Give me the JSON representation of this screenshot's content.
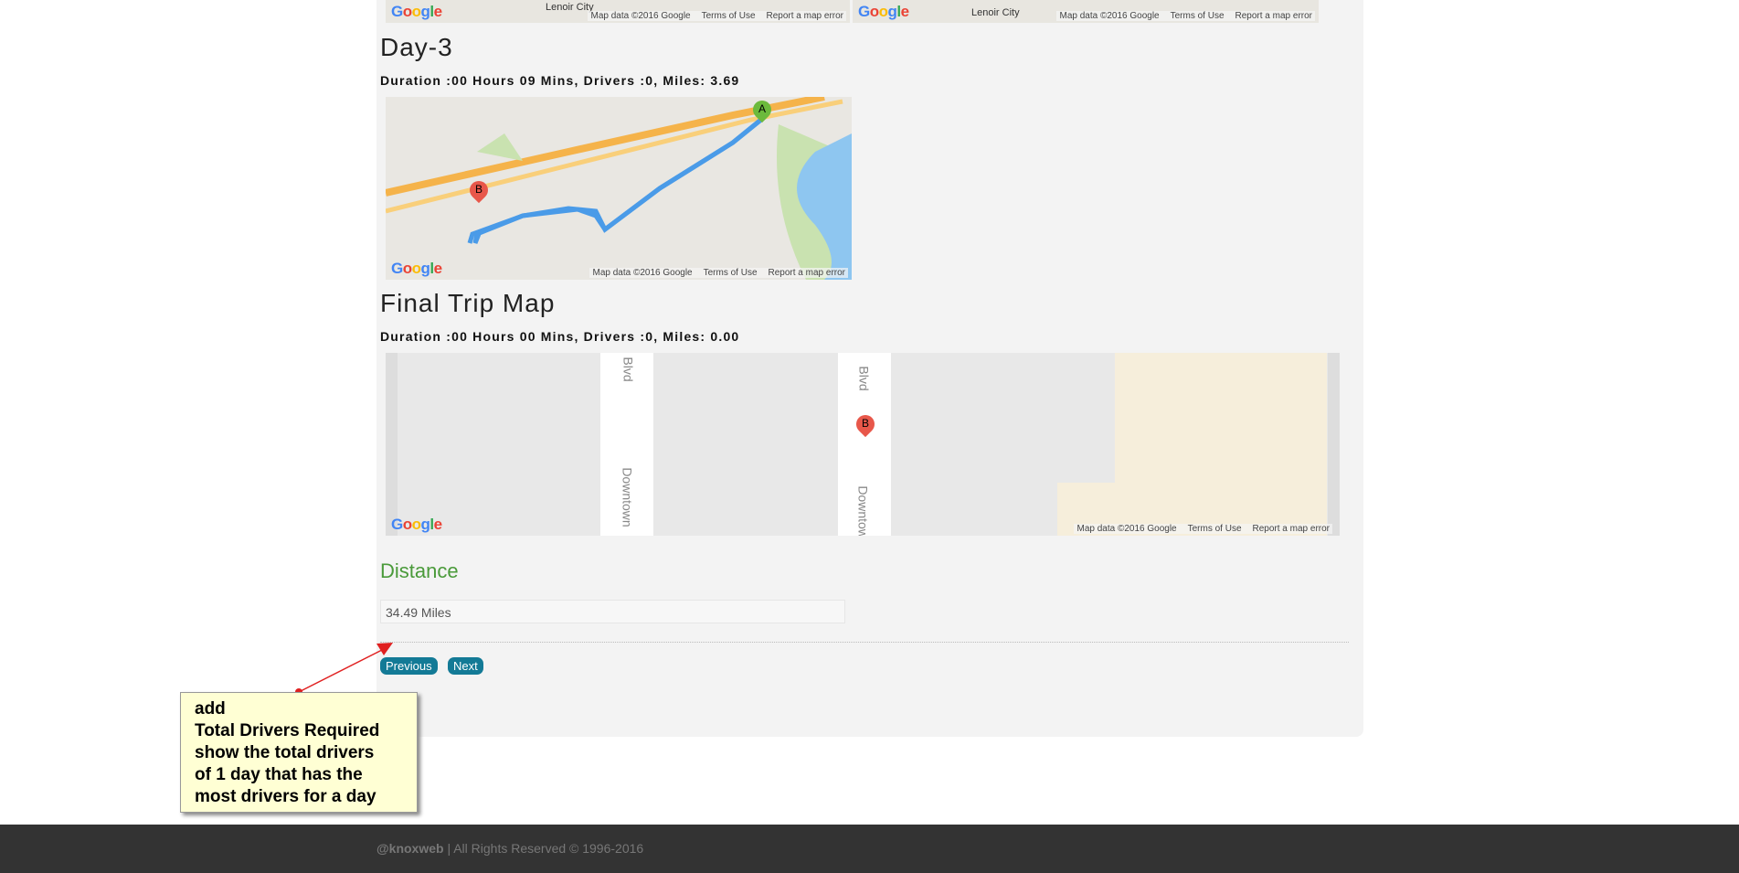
{
  "maps": {
    "google": [
      "G",
      "o",
      "o",
      "g",
      "l",
      "e"
    ],
    "map_data": "Map data ©2016 Google",
    "terms": "Terms of Use",
    "report": "Report a map error",
    "top_label": "Lenoir City"
  },
  "day3": {
    "title": "Day-3",
    "summary": "Duration :00 Hours 09 Mins, Drivers :0, Miles: 3.69",
    "marker_a": "A",
    "marker_b": "B"
  },
  "final": {
    "title": "Final Trip Map",
    "summary": "Duration :00 Hours 00 Mins, Drivers :0, Miles: 0.00",
    "marker_b": "B",
    "street1": "Downtown",
    "street2": "Blvd"
  },
  "distance": {
    "label": "Distance",
    "value": "34.49 Miles"
  },
  "buttons": {
    "previous": "Previous",
    "next": "Next"
  },
  "note": {
    "lines": [
      "add",
      "Total Drivers Required",
      "show the total drivers",
      "of 1 day that has the",
      "most drivers for a day"
    ]
  },
  "footer": {
    "brand": "@knoxweb",
    "text": " | All Rights Reserved © 1996-2016"
  }
}
